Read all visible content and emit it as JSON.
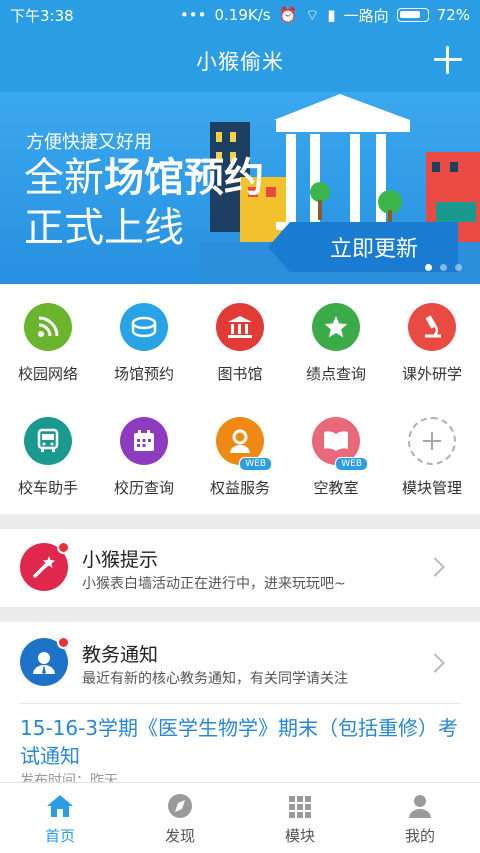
{
  "status": {
    "time": "下午3:38",
    "speed": "0.19K/s",
    "carrier": "一路向",
    "battery": "72%"
  },
  "header": {
    "title": "小猴偷米"
  },
  "banner": {
    "subtitle": "方便快捷又好用",
    "line1_a": "全新",
    "line1_b": "场馆预约",
    "line2": "正式上线",
    "button": "立即更新"
  },
  "grid": {
    "items": [
      {
        "label": "校园网络",
        "color": "#6ab42e"
      },
      {
        "label": "场馆预约",
        "color": "#29a3e5"
      },
      {
        "label": "图书馆",
        "color": "#e23b35"
      },
      {
        "label": "绩点查询",
        "color": "#3bab47"
      },
      {
        "label": "课外研学",
        "color": "#e94b43"
      },
      {
        "label": "校车助手",
        "color": "#1a9a8f"
      },
      {
        "label": "校历查询",
        "color": "#8e3cbf"
      },
      {
        "label": "权益服务",
        "color": "#ee8a13",
        "badge": "WEB"
      },
      {
        "label": "空教室",
        "color": "#e9687a",
        "badge": "WEB"
      },
      {
        "label": "模块管理",
        "color": "#ffffff"
      }
    ]
  },
  "cards": {
    "tips": {
      "title": "小猴提示",
      "desc": "小猴表白墙活动正在进行中，进来玩玩吧~",
      "color": "#e0284d"
    },
    "notice": {
      "title": "教务通知",
      "desc": "最近有新的核心教务通知，有关同学请关注",
      "color": "#1e73c9"
    }
  },
  "notice_item": {
    "title": "15-16-3学期《医学生物学》期末（包括重修）考试通知",
    "meta": "发布时间：昨天"
  },
  "tabs": [
    {
      "label": "首页",
      "icon": "home-icon"
    },
    {
      "label": "发现",
      "icon": "compass-icon"
    },
    {
      "label": "模块",
      "icon": "grid-icon"
    },
    {
      "label": "我的",
      "icon": "user-icon"
    }
  ],
  "colors": {
    "accent": "#2a9de5"
  }
}
